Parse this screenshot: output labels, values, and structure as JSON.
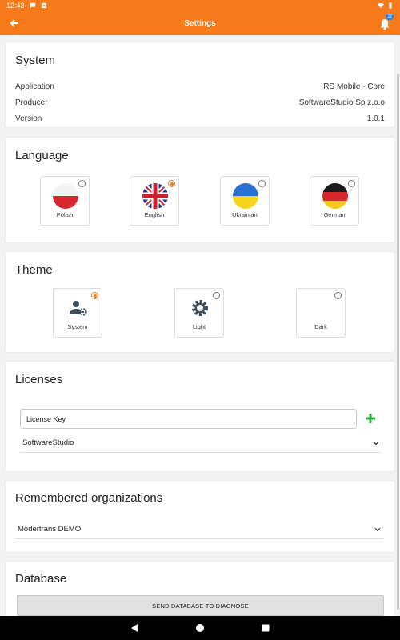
{
  "status_bar": {
    "time": "12:43"
  },
  "app_bar": {
    "title": "Settings",
    "notification_count": "22"
  },
  "colors": {
    "accent": "#f67a1a",
    "plus_green": "#27b13a",
    "badge_blue": "#2f7de1"
  },
  "system": {
    "title": "System",
    "rows": [
      {
        "label": "Application",
        "value": "RS Mobile - Core"
      },
      {
        "label": "Producer",
        "value": "SoftwareStudio Sp z.o.o"
      },
      {
        "label": "Version",
        "value": "1.0.1"
      }
    ]
  },
  "language": {
    "title": "Language",
    "options": [
      {
        "label": "Polish",
        "selected": false
      },
      {
        "label": "English",
        "selected": true
      },
      {
        "label": "Ukrainian",
        "selected": false
      },
      {
        "label": "German",
        "selected": false
      }
    ]
  },
  "theme": {
    "title": "Theme",
    "options": [
      {
        "label": "System",
        "icon": "user-gear-icon",
        "selected": true
      },
      {
        "label": "Light",
        "icon": "sun-gear-icon",
        "selected": false
      },
      {
        "label": "Dark",
        "icon": "moon-icon",
        "selected": false
      }
    ]
  },
  "licenses": {
    "title": "Licenses",
    "input_value": "License Key",
    "selected": "SoftwareStudio"
  },
  "organizations": {
    "title": "Remembered organizations",
    "selected": "Modertrans DEMO"
  },
  "database": {
    "title": "Database",
    "button_label": "SEND DATABASE TO DIAGNOSE"
  }
}
